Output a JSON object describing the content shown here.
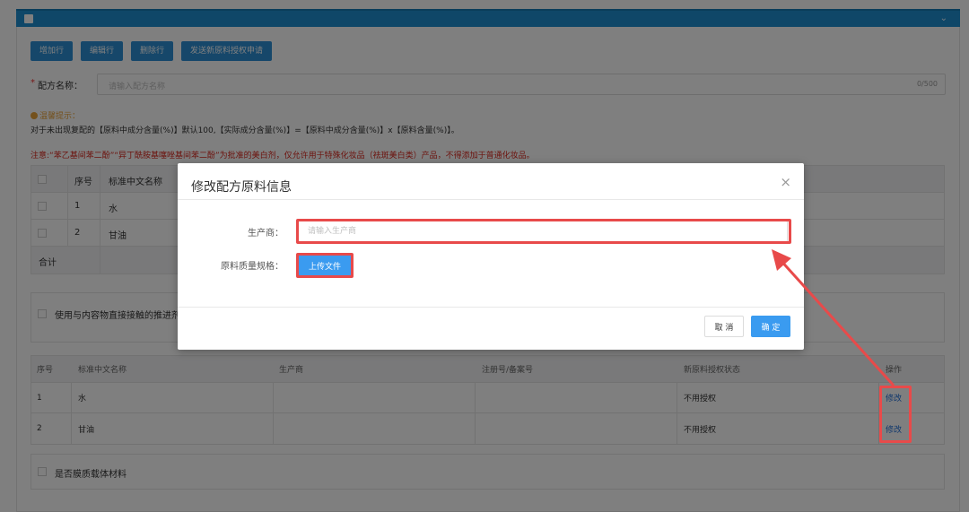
{
  "toolbar": {
    "buttons": [
      {
        "label": "增加行"
      },
      {
        "label": "编辑行"
      },
      {
        "label": "删除行"
      },
      {
        "label": "发送新原料授权申请"
      }
    ]
  },
  "formula": {
    "required_mark": "*",
    "label": "配方名称：",
    "placeholder": "请输入配方名称",
    "counter": "0/500"
  },
  "tips": {
    "title": "温馨提示：",
    "text": "对于未出现复配的【原料中成分含量(%)】默认100,【实际成分含量(%)】=【原料中成分含量(%)】x【原料含量(%)】。",
    "warning": "注意:“苯乙基间苯二酚”“异丁酰胺基噻唑基间苯二酚”为批准的美白剂，仅允许用于特殊化妆品（祛斑美白类）产品，不得添加于普通化妆品。"
  },
  "table1": {
    "headers": {
      "seq": "序号",
      "name": "标准中文名称"
    },
    "rows": [
      {
        "seq": "1",
        "name": "水"
      },
      {
        "seq": "2",
        "name": "甘油"
      }
    ],
    "total_label": "合计"
  },
  "contact": {
    "label": "使用与内容物直接接触的推进剂"
  },
  "table2": {
    "headers": {
      "seq": "序号",
      "name": "标准中文名称",
      "maker": "生产商",
      "reg": "注册号/备案号",
      "status": "新原料授权状态",
      "op": "操作"
    },
    "rows": [
      {
        "seq": "1",
        "name": "水",
        "maker": "",
        "reg": "",
        "status": "不用授权",
        "op": "修改"
      },
      {
        "seq": "2",
        "name": "甘油",
        "maker": "",
        "reg": "",
        "status": "不用授权",
        "op": "修改"
      }
    ]
  },
  "film": {
    "label": "是否膜质载体材料"
  },
  "dialog": {
    "title": "修改配方原料信息",
    "close": "×",
    "manufacturer_label": "生产商：",
    "manufacturer_placeholder": "请输入生产商",
    "spec_label": "原料质量规格：",
    "upload_label": "上传文件",
    "cancel_label": "取 消",
    "ok_label": "确 定"
  },
  "colors": {
    "primary": "#2d8fd5",
    "highlight": "#e84a4a",
    "warning": "#d9261c",
    "tip": "#e8a33a"
  }
}
